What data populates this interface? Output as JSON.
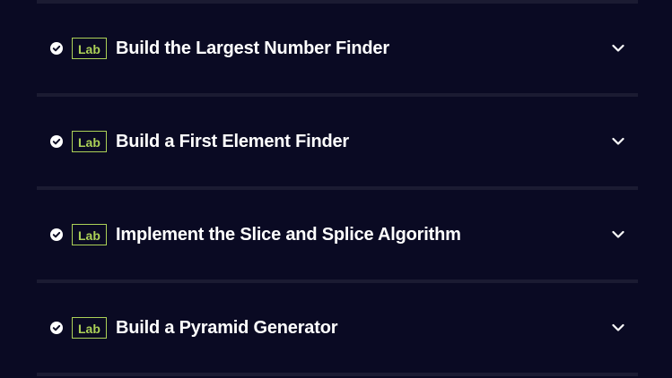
{
  "colors": {
    "background": "#0a0a23",
    "divider": "#1b1b32",
    "badge_accent": "#acd157",
    "text": "#ffffff"
  },
  "items": [
    {
      "badge": "Lab",
      "title": "Build the Largest Number Finder",
      "status_icon": "check-circle-icon",
      "toggle_icon": "chevron-down-icon"
    },
    {
      "badge": "Lab",
      "title": "Build a First Element Finder",
      "status_icon": "check-circle-icon",
      "toggle_icon": "chevron-down-icon"
    },
    {
      "badge": "Lab",
      "title": "Implement the Slice and Splice Algorithm",
      "status_icon": "check-circle-icon",
      "toggle_icon": "chevron-down-icon"
    },
    {
      "badge": "Lab",
      "title": "Build a Pyramid Generator",
      "status_icon": "check-circle-icon",
      "toggle_icon": "chevron-down-icon"
    }
  ]
}
